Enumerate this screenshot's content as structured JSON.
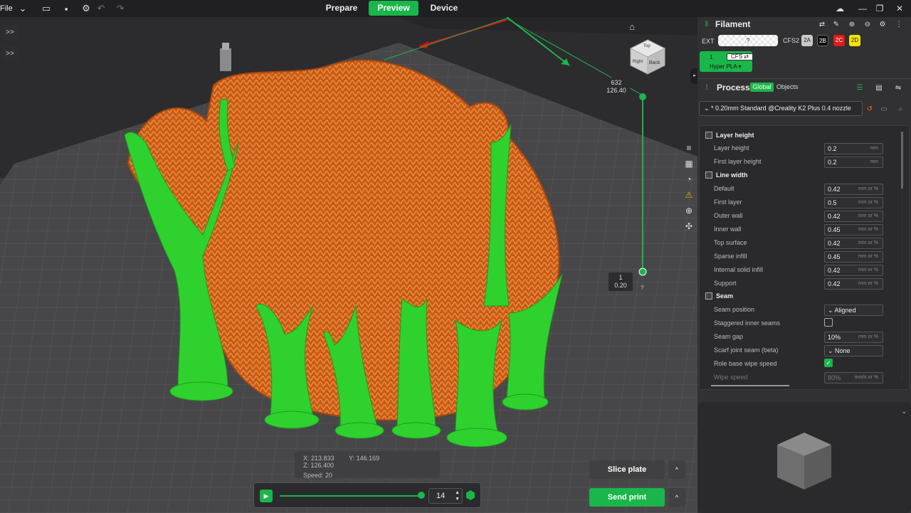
{
  "topbar": {
    "file_label": "File",
    "tabs": [
      {
        "label": "Prepare"
      },
      {
        "label": "Preview"
      },
      {
        "label": "Device"
      }
    ]
  },
  "viewport": {
    "left_buttons": [
      ">>",
      ">>"
    ],
    "cube_faces": {
      "top": "Top",
      "back": "Back",
      "right": "Right"
    },
    "top_label": {
      "line1": "632",
      "line2": "126.40"
    },
    "bottom_label": {
      "line1": "1",
      "line2": "0.20"
    },
    "help_marker": "?",
    "coords": {
      "x": "X: 213.833",
      "y": "Y: 146.169",
      "z": "Z: 126.400",
      "speed": "Speed: 20"
    },
    "layer_value": "14",
    "slice_plate": "Slice plate",
    "send_print": "Send print",
    "caret": "^",
    "colors": {
      "accent": "#1ab64b",
      "model": "#d2601a",
      "support": "#2fd12f"
    }
  },
  "filament": {
    "title": "Filament",
    "ext_label": "EXT",
    "ext_value": "?",
    "cfs_label": "CFS2",
    "chips": [
      {
        "label": "2A",
        "bg": "#c9c9c9",
        "fg": "#222"
      },
      {
        "label": "2B",
        "bg": "#111111",
        "fg": "#fff"
      },
      {
        "label": "2C",
        "bg": "#e01b1b",
        "fg": "#fff"
      },
      {
        "label": "2D",
        "bg": "#f2e20c",
        "fg": "#222"
      }
    ],
    "spool": {
      "number": "1",
      "cfs": "CFS ⇄",
      "name": "Hyper PLA ▾"
    }
  },
  "process": {
    "title": "Process",
    "global_label": "Global",
    "objects_label": "Objects",
    "preset": "* 0.20mm Standard @Creality K2 Plus 0.4 nozzle",
    "sections": [
      {
        "title": "Layer height",
        "rows": [
          {
            "label": "Layer height",
            "value": "0.2",
            "unit": "mm"
          },
          {
            "label": "First layer height",
            "value": "0.2",
            "unit": "mm"
          }
        ]
      },
      {
        "title": "Line width",
        "rows": [
          {
            "label": "Default",
            "value": "0.42",
            "unit": "mm or %"
          },
          {
            "label": "First layer",
            "value": "0.5",
            "unit": "mm or %"
          },
          {
            "label": "Outer wall",
            "value": "0.42",
            "unit": "mm or %"
          },
          {
            "label": "Inner wall",
            "value": "0.45",
            "unit": "mm or %"
          },
          {
            "label": "Top surface",
            "value": "0.42",
            "unit": "mm or %"
          },
          {
            "label": "Sparse infill",
            "value": "0.45",
            "unit": "mm or %"
          },
          {
            "label": "Internal solid infill",
            "value": "0.42",
            "unit": "mm or %"
          },
          {
            "label": "Support",
            "value": "0.42",
            "unit": "mm or %"
          }
        ]
      },
      {
        "title": "Seam",
        "rows": [
          {
            "label": "Seam position",
            "value": "Aligned",
            "unit": ""
          },
          {
            "label": "Staggered inner seams",
            "value": "",
            "unit": ""
          },
          {
            "label": "Seam gap",
            "value": "10%",
            "unit": "mm or %"
          },
          {
            "label": "Scarf joint seam (beta)",
            "value": "None",
            "unit": ""
          },
          {
            "label": "Role base wipe speed",
            "value": "",
            "unit": ""
          },
          {
            "label": "Wipe speed",
            "value": "80%",
            "unit": "mm/s or %"
          }
        ]
      }
    ]
  }
}
